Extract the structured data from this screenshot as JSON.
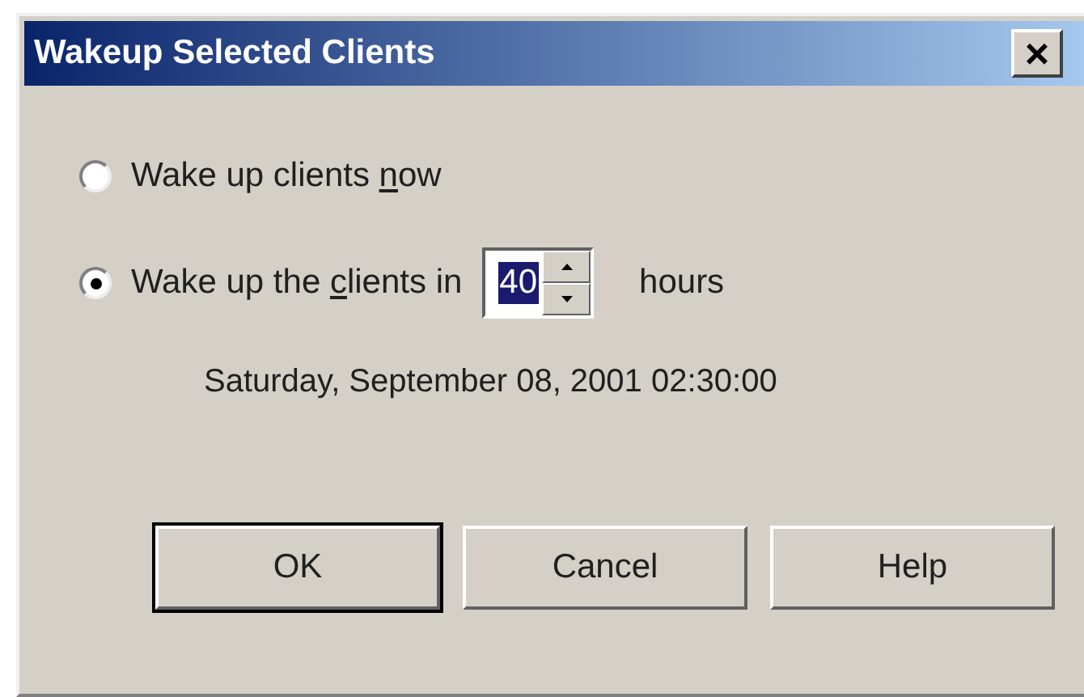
{
  "window": {
    "title": "Wakeup Selected Clients",
    "close": "×"
  },
  "options": [
    {
      "kind": "plain",
      "selected": false,
      "before": "Wake up clients ",
      "key": "n",
      "after": "ow"
    },
    {
      "kind": "spinner",
      "selected": true,
      "before": "Wake up the ",
      "key": "c",
      "after": "lients in",
      "value": "40",
      "unit": "hours"
    }
  ],
  "date": "Saturday, September 08, 2001 02:30:00",
  "buttons": [
    {
      "label": "OK",
      "default": true
    },
    {
      "label": "Cancel",
      "default": false
    },
    {
      "label": "Help",
      "default": false
    }
  ]
}
